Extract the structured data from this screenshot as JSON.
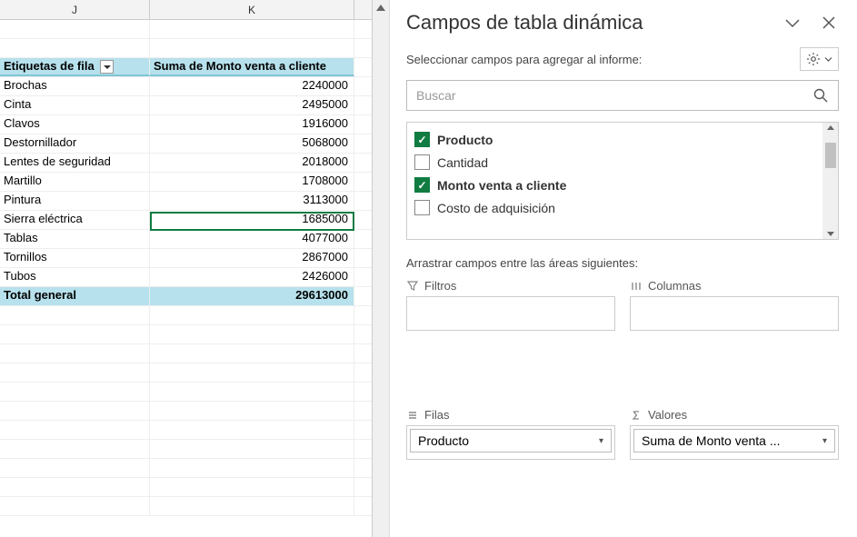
{
  "columns": {
    "j": "J",
    "k": "K"
  },
  "pivot": {
    "row_label_header": "Etiquetas de fila",
    "value_header": "Suma de Monto venta a cliente",
    "rows": [
      {
        "label": "Brochas",
        "value": "2240000"
      },
      {
        "label": "Cinta",
        "value": "2495000"
      },
      {
        "label": "Clavos",
        "value": "1916000"
      },
      {
        "label": "Destornillador",
        "value": "5068000"
      },
      {
        "label": "Lentes de seguridad",
        "value": "2018000"
      },
      {
        "label": "Martillo",
        "value": "1708000"
      },
      {
        "label": "Pintura",
        "value": "3113000"
      },
      {
        "label": "Sierra eléctrica",
        "value": "1685000"
      },
      {
        "label": "Tablas",
        "value": "4077000"
      },
      {
        "label": "Tornillos",
        "value": "2867000"
      },
      {
        "label": "Tubos",
        "value": "2426000"
      }
    ],
    "total_label": "Total general",
    "total_value": "29613000"
  },
  "pane": {
    "title": "Campos de tabla dinámica",
    "subtitle": "Seleccionar campos para agregar al informe:",
    "search_placeholder": "Buscar",
    "fields": [
      {
        "label": "Producto",
        "checked": true
      },
      {
        "label": "Cantidad",
        "checked": false
      },
      {
        "label": "Monto venta a cliente",
        "checked": true
      },
      {
        "label": "Costo de adquisición",
        "checked": false
      }
    ],
    "drag_label": "Arrastrar campos entre las áreas siguientes:",
    "areas": {
      "filters": {
        "title": "Filtros"
      },
      "columns": {
        "title": "Columnas"
      },
      "rows": {
        "title": "Filas",
        "item": "Producto"
      },
      "values": {
        "title": "Valores",
        "item": "Suma de Monto venta ..."
      }
    }
  }
}
